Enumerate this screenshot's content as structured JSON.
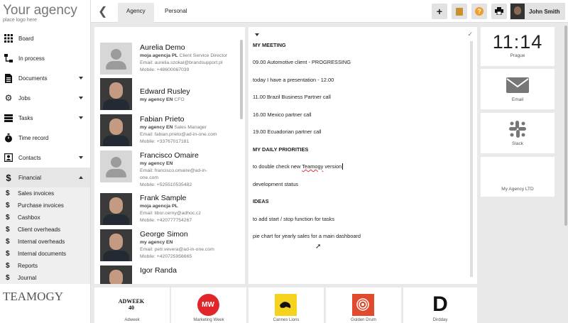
{
  "brand": {
    "title": "Your agency",
    "subtitle": "place logo here",
    "footer_logo": "TEAMOGY"
  },
  "nav": [
    {
      "label": "Board",
      "icon": "grid-icon"
    },
    {
      "label": "In process",
      "icon": "flow-icon"
    },
    {
      "label": "Documents",
      "icon": "document-icon"
    },
    {
      "label": "Jobs",
      "icon": "gears-icon"
    },
    {
      "label": "Tasks",
      "icon": "tasks-icon"
    },
    {
      "label": "Time record",
      "icon": "stopwatch-icon"
    },
    {
      "label": "Contacts",
      "icon": "contact-card-icon"
    },
    {
      "label": "Financial",
      "icon": "dollar-icon"
    }
  ],
  "financial_sub": [
    "Sales invoices",
    "Purchase invoices",
    "Cashbox",
    "Client overheads",
    "Internal overheads",
    "Internal documents",
    "Reports",
    "Journal"
  ],
  "tabs": [
    "Agency",
    "Personal"
  ],
  "user": {
    "name": "John Smith"
  },
  "contacts": [
    {
      "name": "Aurelia Demo",
      "company": "moja agencja PL",
      "role": "Client Service Director",
      "email": "Email: aurelia.szokal@brandsupport.pl",
      "mobile": "Mobile: +48600067039",
      "extra": ""
    },
    {
      "name": "Edward Rusley",
      "company": "my agency EN",
      "role": "CFO",
      "email": "",
      "mobile": "",
      "extra": ""
    },
    {
      "name": "Fabian Prieto",
      "company": "my agency EN",
      "role": "Sales Manager",
      "email": "Email: fabian.prieto@ad-in-one.com",
      "mobile": "Mobile: +33767017181",
      "extra": ""
    },
    {
      "name": "Francisco Omaire",
      "company": "my agency EN",
      "role": "",
      "email": "Email: francisco.omaire@ad-in-",
      "mobile": "one.com",
      "extra": "Mobile: +525510535482"
    },
    {
      "name": "Frank Sample",
      "company": "moja agencja PL",
      "role": "",
      "email": "Email: libor.cerny@adhoc.cz",
      "mobile": "Mobile: +420777754267",
      "extra": ""
    },
    {
      "name": "George Simon",
      "company": "my agency EN",
      "role": "",
      "email": "Email: petr.vevera@ad-in-one.com",
      "mobile": "Mobile: +420725956665",
      "extra": ""
    },
    {
      "name": "Igor Randa",
      "company": "",
      "role": "",
      "email": "",
      "mobile": "",
      "extra": ""
    }
  ],
  "notes": {
    "lines": [
      "MY MEETING",
      "09.00 Automotive client - PROGRESSING",
      "today I have a presentation - 12.00",
      "11.00 Brazil Business Partner call",
      "16.00 Mexico partner call",
      "19.00 Ecuadorian partner call",
      "MY DAILY PRIORITIES",
      "development status",
      "IDEAS",
      "to add start / stop function  for tasks",
      "pie chart for yearly sales for a main dashboard"
    ],
    "priority_prefix": "to double check new ",
    "priority_word": "Teamogy",
    "priority_suffix": " version"
  },
  "widgets": {
    "clock_time": "11:14",
    "clock_city": "Prague",
    "email": "Email",
    "slack": "Slack",
    "agency": "My Agency LTD"
  },
  "tiles": [
    {
      "label": "Adweek",
      "logo": "ADWEEK 40"
    },
    {
      "label": "Marketing Week",
      "logo": "MW"
    },
    {
      "label": "Cannes Lions",
      "logo": ""
    },
    {
      "label": "Golden Drum",
      "logo": ""
    },
    {
      "label": "Dirdday",
      "logo": "D"
    }
  ],
  "colors": {
    "mw_red": "#e0262b",
    "cannes_yellow": "#f5d21c",
    "golden_drum": "#e24a2d",
    "toolbar_orange": "#f39c2b"
  }
}
